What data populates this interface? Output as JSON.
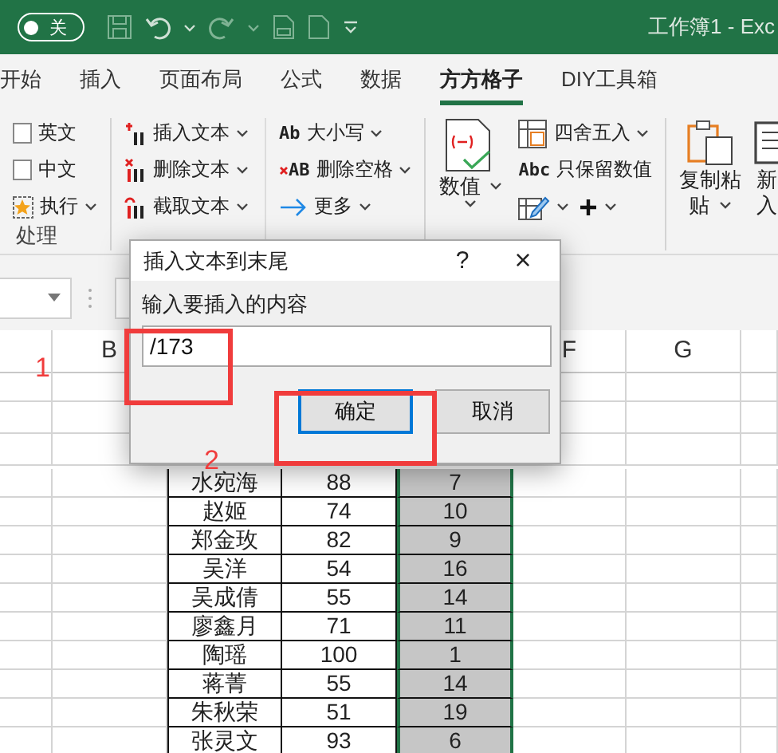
{
  "title_bar": {
    "autosave": {
      "label": "关",
      "on": false
    },
    "title": "工作簿1 - Exc"
  },
  "tabs": [
    {
      "label": "开始",
      "selected": false
    },
    {
      "label": "插入",
      "selected": false
    },
    {
      "label": "页面布局",
      "selected": false
    },
    {
      "label": "公式",
      "selected": false
    },
    {
      "label": "数据",
      "selected": false
    },
    {
      "label": "方方格子",
      "selected": true
    },
    {
      "label": "DIY工具箱",
      "selected": false
    }
  ],
  "ribbon": {
    "groups": [
      {
        "label": "处理",
        "columns": [
          [
            {
              "label": "英文",
              "kind": "check"
            },
            {
              "label": "中文",
              "kind": "check"
            },
            {
              "label": "执行",
              "kind": "star",
              "caret": true
            }
          ]
        ]
      },
      {
        "columns": [
          [
            {
              "label": "插入文本",
              "kind": "insert",
              "caret": true
            },
            {
              "label": "删除文本",
              "kind": "delete",
              "caret": true
            },
            {
              "label": "截取文本",
              "kind": "cut",
              "caret": true
            }
          ],
          [
            {
              "label": "大小写",
              "kind": "glyph",
              "glyph": "Ab",
              "caret": true
            },
            {
              "label": "删除空格",
              "kind": "glyph-x",
              "glyph": "AB",
              "caret": true
            },
            {
              "label": "更多",
              "kind": "arrow",
              "caret": true
            }
          ]
        ]
      },
      {
        "big": [
          {
            "lines": [
              "数值"
            ],
            "kind": "number",
            "caret": true
          }
        ],
        "columns": [
          [
            {
              "label": "四舍五入",
              "kind": "round",
              "caret": true
            },
            {
              "label": "只保留数值",
              "kind": "glyph",
              "glyph": "Abc"
            },
            {
              "kind": "icons",
              "items": [
                {
                  "kind": "edit",
                  "caret": true
                },
                {
                  "kind": "plus",
                  "caret": true
                }
              ]
            }
          ]
        ]
      },
      {
        "big": [
          {
            "lines": [
              "复制粘",
              "贴"
            ],
            "kind": "paste",
            "caret": true
          },
          {
            "lines": [
              "新",
              "入"
            ],
            "kind": "sheet"
          }
        ]
      }
    ]
  },
  "sheet": {
    "column_headers": [
      "B",
      "F",
      "G"
    ],
    "rank_column_selected": true,
    "rows": [
      {
        "name": "水宛海",
        "score": "88",
        "rank": "7"
      },
      {
        "name": "赵姬",
        "score": "74",
        "rank": "10"
      },
      {
        "name": "郑金玫",
        "score": "82",
        "rank": "9"
      },
      {
        "name": "吴洋",
        "score": "54",
        "rank": "16"
      },
      {
        "name": "吴成倩",
        "score": "55",
        "rank": "14"
      },
      {
        "name": "廖鑫月",
        "score": "71",
        "rank": "11"
      },
      {
        "name": "陶瑶",
        "score": "100",
        "rank": "1"
      },
      {
        "name": "蒋菁",
        "score": "55",
        "rank": "14"
      },
      {
        "name": "朱秋荣",
        "score": "51",
        "rank": "19"
      },
      {
        "name": "张灵文",
        "score": "93",
        "rank": "6"
      }
    ]
  },
  "dialog": {
    "title": "插入文本到末尾",
    "help": "?",
    "close": "×",
    "prompt": "输入要插入的内容",
    "value": "/173",
    "buttons": [
      {
        "label": "确定",
        "focused": true
      },
      {
        "label": "取消",
        "focused": false
      }
    ]
  },
  "annotations": [
    {
      "label": "1"
    },
    {
      "label": "2"
    }
  ]
}
